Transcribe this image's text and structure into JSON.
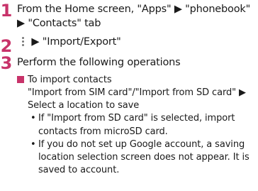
{
  "colors": {
    "step_number": "#c8336a",
    "square_marker": "#c8336a",
    "text": "#1a1a1a"
  },
  "steps": [
    {
      "number": "1",
      "text": "From the Home screen, \"Apps\" ▶ \"phonebook\" ▶ \"Contacts\" tab"
    },
    {
      "number": "2",
      "icon": "more-options-icon",
      "text": "▶ \"Import/Export\""
    },
    {
      "number": "3",
      "text": "Perform the following operations"
    }
  ],
  "import_section": {
    "heading": "To import contacts",
    "instruction": "\"Import from SIM card\"/\"Import from SD card\" ▶ Select a location to save",
    "notes": [
      "If \"Import from SD card\" is selected, import contacts from microSD card.",
      "If you do not set up Google account, a saving location selection screen does not appear. It is saved to account."
    ]
  }
}
